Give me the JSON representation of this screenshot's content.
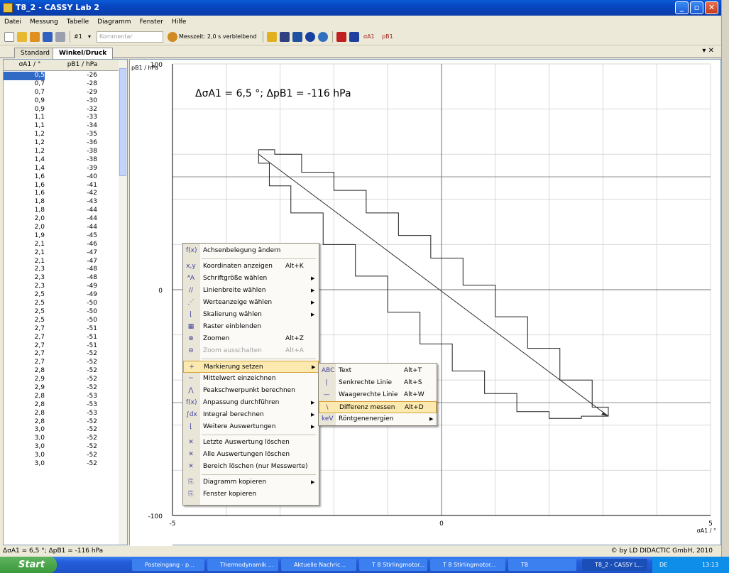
{
  "window": {
    "title": "T8_2 - CASSY Lab 2",
    "controls": [
      "_",
      "▫",
      "✕"
    ]
  },
  "menu": [
    "Datei",
    "Messung",
    "Tabelle",
    "Diagramm",
    "Fenster",
    "Hilfe"
  ],
  "toolbar": {
    "counter": "#1",
    "comment_placeholder": "Kommentar",
    "measure_time": "Messzeit: 2,0 s verbleibend",
    "ch1": "σA1",
    "ch2": "pB1"
  },
  "tabs": [
    "Standard",
    "Winkel/Druck"
  ],
  "tab_close": "▾ ✕",
  "table": {
    "headers": [
      "σA1 / °",
      "pB1 / hPa"
    ],
    "rows": [
      [
        "0,5",
        "-26"
      ],
      [
        "0,7",
        "-28"
      ],
      [
        "0,7",
        "-29"
      ],
      [
        "0,9",
        "-30"
      ],
      [
        "0,9",
        "-32"
      ],
      [
        "1,1",
        "-33"
      ],
      [
        "1,1",
        "-34"
      ],
      [
        "1,2",
        "-35"
      ],
      [
        "1,2",
        "-36"
      ],
      [
        "1,2",
        "-38"
      ],
      [
        "1,4",
        "-38"
      ],
      [
        "1,4",
        "-39"
      ],
      [
        "1,6",
        "-40"
      ],
      [
        "1,6",
        "-41"
      ],
      [
        "1,6",
        "-42"
      ],
      [
        "1,8",
        "-43"
      ],
      [
        "1,8",
        "-44"
      ],
      [
        "2,0",
        "-44"
      ],
      [
        "2,0",
        "-44"
      ],
      [
        "1,9",
        "-45"
      ],
      [
        "2,1",
        "-46"
      ],
      [
        "2,1",
        "-47"
      ],
      [
        "2,1",
        "-47"
      ],
      [
        "2,3",
        "-48"
      ],
      [
        "2,3",
        "-48"
      ],
      [
        "2,3",
        "-49"
      ],
      [
        "2,5",
        "-49"
      ],
      [
        "2,5",
        "-50"
      ],
      [
        "2,5",
        "-50"
      ],
      [
        "2,5",
        "-50"
      ],
      [
        "2,7",
        "-51"
      ],
      [
        "2,7",
        "-51"
      ],
      [
        "2,7",
        "-51"
      ],
      [
        "2,7",
        "-52"
      ],
      [
        "2,7",
        "-52"
      ],
      [
        "2,8",
        "-52"
      ],
      [
        "2,9",
        "-52"
      ],
      [
        "2,9",
        "-52"
      ],
      [
        "2,8",
        "-53"
      ],
      [
        "2,8",
        "-53"
      ],
      [
        "2,8",
        "-53"
      ],
      [
        "2,8",
        "-52"
      ],
      [
        "3,0",
        "-52"
      ],
      [
        "3,0",
        "-52"
      ],
      [
        "3,0",
        "-52"
      ],
      [
        "3,0",
        "-52"
      ],
      [
        "3,0",
        "-52"
      ]
    ]
  },
  "chart_data": {
    "type": "line",
    "xlabel": "σA1 / °",
    "ylabel": "pB1 / hPa",
    "xlim": [
      -5,
      5
    ],
    "ylim": [
      -100,
      100
    ],
    "x_ticks": [
      "-5",
      "0",
      "5"
    ],
    "y_ticks": [
      "100",
      "0",
      "-100"
    ],
    "grid": true,
    "annotation": "ΔσA1 = 6,5 °;  ΔpB1 = -116 hPa",
    "difference_line": {
      "x": [
        -3.4,
        3.1
      ],
      "y": [
        60,
        -56
      ]
    },
    "loop_upper": {
      "x": [
        -3.4,
        -3.1,
        -2.6,
        -2.0,
        -1.4,
        -0.8,
        -0.2,
        0.4,
        1.0,
        1.6,
        2.2,
        2.8,
        3.1
      ],
      "y": [
        62,
        60,
        52,
        44,
        34,
        24,
        14,
        2,
        -12,
        -26,
        -40,
        -52,
        -56
      ]
    },
    "loop_lower": {
      "x": [
        3.1,
        2.6,
        2.0,
        1.4,
        0.8,
        0.2,
        -0.4,
        -1.0,
        -1.6,
        -2.2,
        -2.8,
        -3.2,
        -3.4
      ],
      "y": [
        -56,
        -57,
        -54,
        -46,
        -36,
        -24,
        -10,
        6,
        20,
        34,
        46,
        56,
        62
      ]
    }
  },
  "status": {
    "left": "ΔσA1 = 6,5 °;  ΔpB1 = -116 hPa",
    "right": "© by LD DIDACTIC GmbH, 2010"
  },
  "context_menu": {
    "items": [
      {
        "label": "Achsenbelegung ändern",
        "shortcut": "",
        "icon": "axis-assign-icon",
        "glyph": "f(x)",
        "submenu": false,
        "disabled": false
      },
      {
        "label": "Koordinaten anzeigen",
        "shortcut": "Alt+K",
        "icon": "coordinates-icon",
        "glyph": "x,y",
        "submenu": false,
        "disabled": false
      },
      {
        "label": "Schriftgröße wählen",
        "shortcut": "",
        "icon": "font-size-icon",
        "glyph": "ᴬA",
        "submenu": true,
        "disabled": false
      },
      {
        "label": "Linienbreite wählen",
        "shortcut": "",
        "icon": "line-width-icon",
        "glyph": "//",
        "submenu": true,
        "disabled": false
      },
      {
        "label": "Werteanzeige wählen",
        "shortcut": "",
        "icon": "value-display-icon",
        "glyph": "⋰",
        "submenu": true,
        "disabled": false
      },
      {
        "label": "Skalierung wählen",
        "shortcut": "",
        "icon": "scaling-icon",
        "glyph": "⌊",
        "submenu": true,
        "disabled": false
      },
      {
        "label": "Raster einblenden",
        "shortcut": "",
        "icon": "grid-icon",
        "glyph": "▦",
        "submenu": false,
        "disabled": false
      },
      {
        "label": "Zoomen",
        "shortcut": "Alt+Z",
        "icon": "zoom-icon",
        "glyph": "⊕",
        "submenu": false,
        "disabled": false
      },
      {
        "label": "Zoom ausschalten",
        "shortcut": "Alt+A",
        "icon": "zoom-off-icon",
        "glyph": "⊖",
        "submenu": false,
        "disabled": true
      },
      {
        "label": "Markierung setzen",
        "shortcut": "",
        "icon": "marker-icon",
        "glyph": "+",
        "submenu": true,
        "disabled": false,
        "highlight": true
      },
      {
        "label": "Mittelwert einzeichnen",
        "shortcut": "",
        "icon": "mean-icon",
        "glyph": "~",
        "submenu": false,
        "disabled": false
      },
      {
        "label": "Peakschwerpunkt berechnen",
        "shortcut": "",
        "icon": "peak-icon",
        "glyph": "⋀",
        "submenu": false,
        "disabled": false
      },
      {
        "label": "Anpassung durchführen",
        "shortcut": "",
        "icon": "fit-icon",
        "glyph": "f(x)",
        "submenu": true,
        "disabled": false
      },
      {
        "label": "Integral berechnen",
        "shortcut": "",
        "icon": "integral-icon",
        "glyph": "∫dx",
        "submenu": true,
        "disabled": false
      },
      {
        "label": "Weitere Auswertungen",
        "shortcut": "",
        "icon": "more-analysis-icon",
        "glyph": "⌊",
        "submenu": true,
        "disabled": false
      },
      {
        "label": "Letzte Auswertung löschen",
        "shortcut": "",
        "icon": "delete-last-icon",
        "glyph": "✕",
        "submenu": false,
        "disabled": false
      },
      {
        "label": "Alle Auswertungen löschen",
        "shortcut": "",
        "icon": "delete-all-icon",
        "glyph": "✕",
        "submenu": false,
        "disabled": false
      },
      {
        "label": "Bereich löschen (nur Messwerte)",
        "shortcut": "",
        "icon": "delete-range-icon",
        "glyph": "✕",
        "submenu": false,
        "disabled": false
      },
      {
        "label": "Diagramm kopieren",
        "shortcut": "",
        "icon": "copy-chart-icon",
        "glyph": "⎘",
        "submenu": true,
        "disabled": false
      },
      {
        "label": "Fenster kopieren",
        "shortcut": "",
        "icon": "copy-window-icon",
        "glyph": "⎘",
        "submenu": false,
        "disabled": false
      }
    ]
  },
  "submenu": {
    "items": [
      {
        "label": "Text",
        "shortcut": "Alt+T",
        "icon": "text-icon",
        "glyph": "ABC",
        "submenu": false
      },
      {
        "label": "Senkrechte Linie",
        "shortcut": "Alt+S",
        "icon": "vertical-line-icon",
        "glyph": "|",
        "submenu": false
      },
      {
        "label": "Waagerechte Linie",
        "shortcut": "Alt+W",
        "icon": "horizontal-line-icon",
        "glyph": "—",
        "submenu": false
      },
      {
        "label": "Differenz messen",
        "shortcut": "Alt+D",
        "icon": "difference-icon",
        "glyph": "\\",
        "submenu": false,
        "highlight": true
      },
      {
        "label": "Röntgenenergien",
        "shortcut": "",
        "icon": "xray-icon",
        "glyph": "keV",
        "submenu": true
      }
    ]
  },
  "taskbar": {
    "start": "Start",
    "tasks": [
      "Posteingang - p...",
      "Thermodynamik ...",
      "Aktuelle Nachric...",
      "T 8 Stirlingmotor...",
      "T 8 Stirlingmotor...",
      "T8",
      "T8_2 - CASSY L..."
    ],
    "lang": "DE",
    "clock": "13:13"
  },
  "colors": {
    "title": "#0a5cd8",
    "menu_hl": "#fbe9b0",
    "selection": "#316ac5",
    "taskbar": "#245edb"
  }
}
